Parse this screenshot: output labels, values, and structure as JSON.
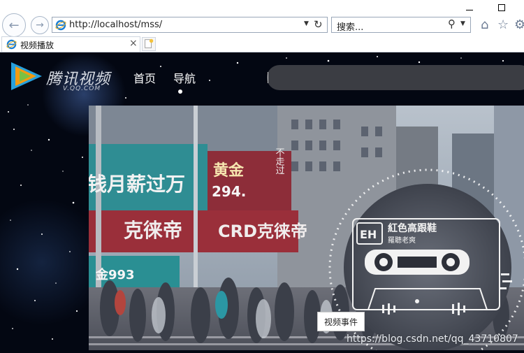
{
  "browser": {
    "url": "http://localhost/mss/",
    "search_placeholder": "搜索...",
    "tab_title": "视频播放",
    "tab_close": "×"
  },
  "site": {
    "logo_text": "腾讯视频",
    "logo_sub": "V.QQ.COM",
    "nav": [
      "首页",
      "导航"
    ]
  },
  "video": {
    "signs": {
      "left_red_line1": "钱月薪过万",
      "mid_red": "克徕帝",
      "mid_red_brand": "CRD克徕帝",
      "gold": "黄金",
      "gold_value": "294.",
      "side_price": "金993",
      "vertical": "不走过"
    },
    "cassette": {
      "brand": "EH",
      "title": "紅色高跟鞋",
      "artist": "羅聽老爽"
    }
  },
  "button": {
    "video_events": "视频事件"
  },
  "watermark": "https://blog.csdn.net/qq_43710807",
  "colors": {
    "page_bg": "#030712",
    "search_bar": "#3b3d43",
    "logo_blue": "#27a0dc",
    "logo_orange": "#f39c12"
  }
}
